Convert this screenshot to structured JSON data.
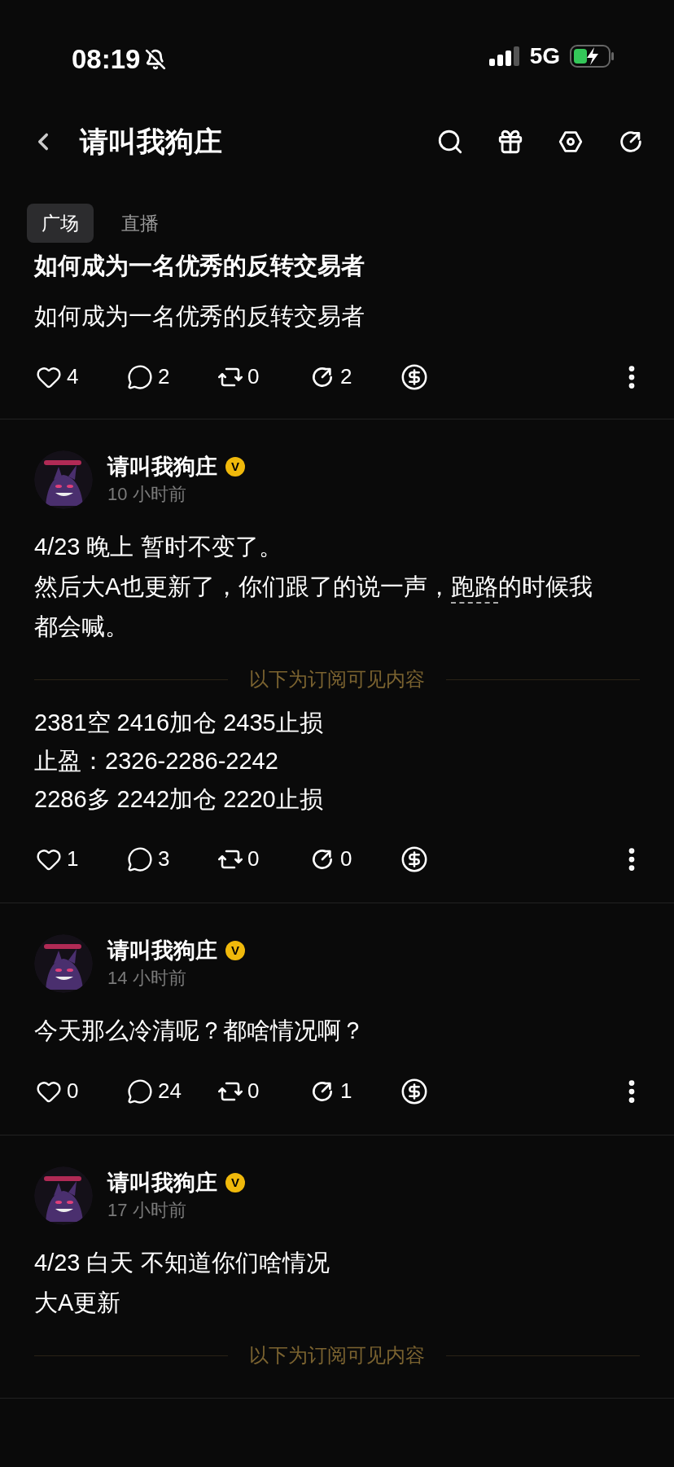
{
  "status_bar": {
    "time": "08:19",
    "network": "5G"
  },
  "header": {
    "title": "请叫我狗庄"
  },
  "tabs": [
    {
      "label": "广场",
      "selected": true
    },
    {
      "label": "直播",
      "selected": false
    }
  ],
  "posts": [
    {
      "kind": "article",
      "title": "如何成为一名优秀的反转交易者",
      "body": [
        [
          {
            "text": "如何成为一名优秀的反转交易者",
            "link": false
          }
        ]
      ],
      "actions": [
        {
          "kind": "like",
          "count": "4"
        },
        {
          "kind": "comment",
          "count": "2"
        },
        {
          "kind": "repost",
          "count": "0"
        },
        {
          "kind": "share",
          "count": "2"
        },
        {
          "kind": "tip"
        }
      ]
    },
    {
      "kind": "feed",
      "author": "请叫我狗庄",
      "badge": "V",
      "time": "10 小时前",
      "body": [
        [
          {
            "text": "4/23 晚上 暂时不变了。",
            "link": false
          }
        ],
        [
          {
            "text": "然后大A也更新了，你们跟了的说一声，",
            "link": false
          },
          {
            "text": "跑路",
            "link": true
          },
          {
            "text": "的时候我",
            "link": false
          }
        ],
        [
          {
            "text": "都会喊。",
            "link": false
          }
        ]
      ],
      "locked_label": "以下为订阅可见内容",
      "locked_lines": [
        "2381空 2416加仓 2435止损",
        "止盈：2326-2286-2242",
        "2286多 2242加仓 2220止损"
      ],
      "actions": [
        {
          "kind": "like",
          "count": "1"
        },
        {
          "kind": "comment",
          "count": "3"
        },
        {
          "kind": "repost",
          "count": "0"
        },
        {
          "kind": "share",
          "count": "0"
        },
        {
          "kind": "tip"
        }
      ]
    },
    {
      "kind": "feed",
      "author": "请叫我狗庄",
      "badge": "V",
      "time": "14 小时前",
      "body": [
        [
          {
            "text": "今天那么冷清呢？都啥情况啊？",
            "link": false
          }
        ]
      ],
      "actions": [
        {
          "kind": "like",
          "count": "0"
        },
        {
          "kind": "comment",
          "count": "24"
        },
        {
          "kind": "repost",
          "count": "0"
        },
        {
          "kind": "share",
          "count": "1"
        },
        {
          "kind": "tip"
        }
      ]
    },
    {
      "kind": "feed",
      "author": "请叫我狗庄",
      "badge": "V",
      "time": "17 小时前",
      "body": [
        [
          {
            "text": "4/23 白天 不知道你们啥情况",
            "link": false
          }
        ],
        [
          {
            "text": "大A更新",
            "link": false
          }
        ]
      ],
      "locked_label": "以下为订阅可见内容"
    }
  ]
}
